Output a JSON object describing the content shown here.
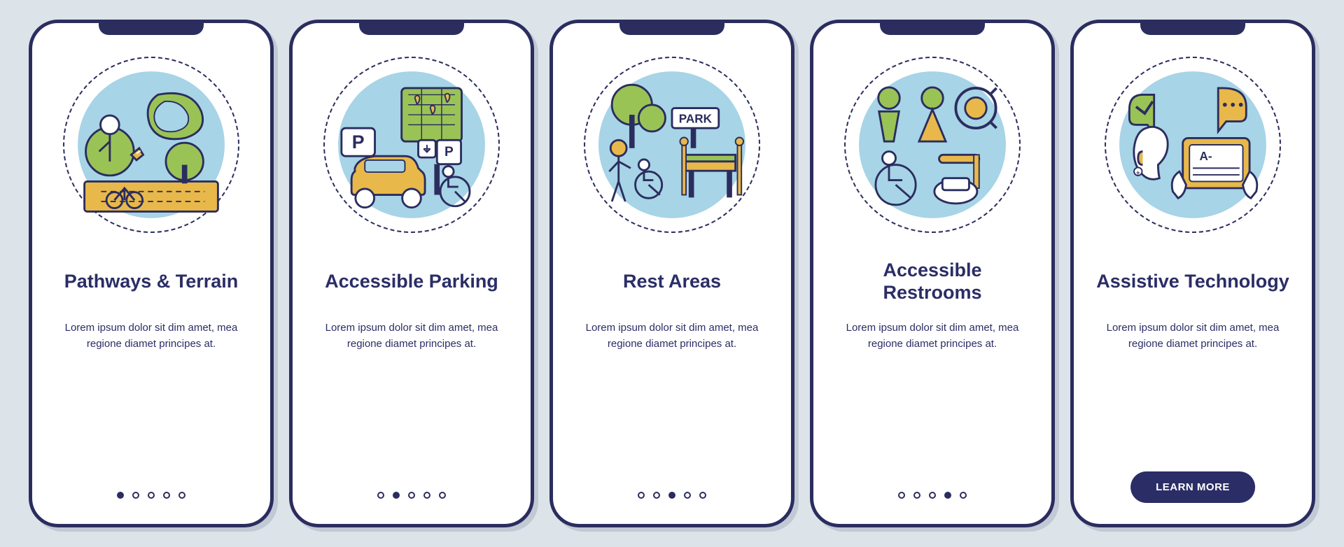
{
  "cards": [
    {
      "title": "Pathways & Terrain",
      "body": "Lorem ipsum dolor sit dim amet, mea regione diamet principes at.",
      "hasCta": false,
      "activeDot": 0,
      "iconName": "pathways-terrain-icon"
    },
    {
      "title": "Accessible Parking",
      "body": "Lorem ipsum dolor sit dim amet, mea regione diamet principes at.",
      "hasCta": false,
      "activeDot": 1,
      "iconName": "accessible-parking-icon"
    },
    {
      "title": "Rest Areas",
      "body": "Lorem ipsum dolor sit dim amet, mea regione diamet principes at.",
      "hasCta": false,
      "activeDot": 2,
      "iconName": "rest-areas-icon"
    },
    {
      "title": "Accessible Restrooms",
      "body": "Lorem ipsum dolor sit dim amet, mea regione diamet principes at.",
      "hasCta": false,
      "activeDot": 3,
      "iconName": "accessible-restrooms-icon"
    },
    {
      "title": "Assistive Technology",
      "body": "Lorem ipsum dolor sit dim amet, mea regione diamet principes at.",
      "hasCta": true,
      "ctaLabel": "LEARN MORE",
      "iconName": "assistive-technology-icon"
    }
  ],
  "dotCount": 5,
  "colors": {
    "frame": "#2b2d5f",
    "accentGreen": "#9ac356",
    "accentYellow": "#e8b84a",
    "accentBlue": "#a7d4e6",
    "text": "#2b2d66"
  }
}
